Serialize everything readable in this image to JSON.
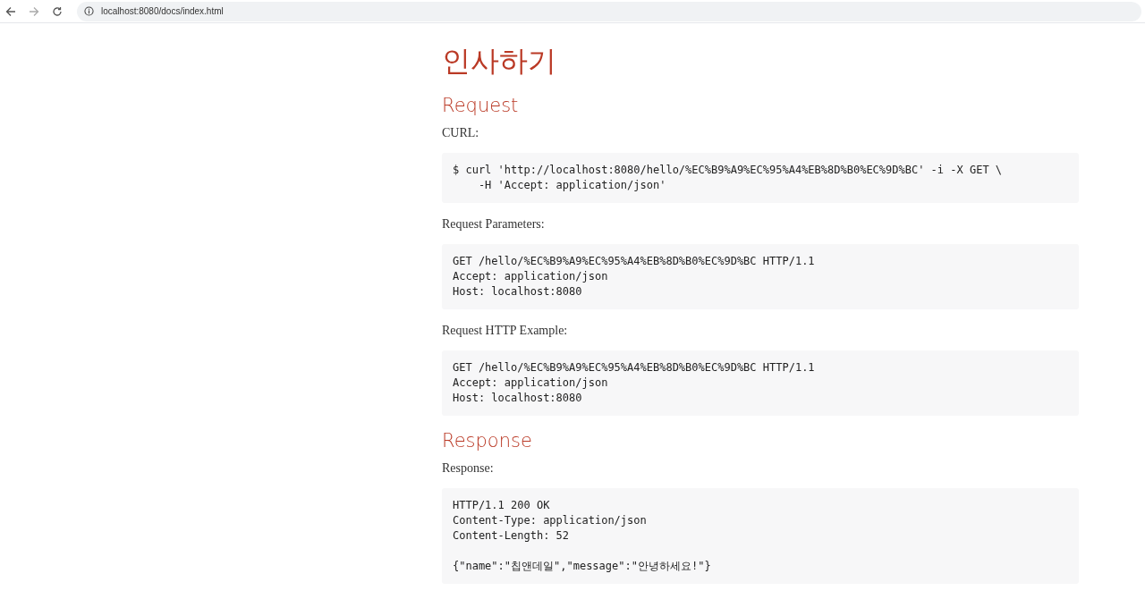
{
  "browser": {
    "address": "localhost:8080/docs/index.html"
  },
  "title": "인사하기",
  "blocks": [
    {
      "kind": "heading",
      "text": "Request"
    },
    {
      "kind": "label",
      "text": "CURL:"
    },
    {
      "kind": "code",
      "text": "$ curl 'http://localhost:8080/hello/%EC%B9%A9%EC%95%A4%EB%8D%B0%EC%9D%BC' -i -X GET \\\n    -H 'Accept: application/json'"
    },
    {
      "kind": "label",
      "text": "Request Parameters:"
    },
    {
      "kind": "code",
      "text": "GET /hello/%EC%B9%A9%EC%95%A4%EB%8D%B0%EC%9D%BC HTTP/1.1\nAccept: application/json\nHost: localhost:8080"
    },
    {
      "kind": "label",
      "text": "Request HTTP Example:"
    },
    {
      "kind": "code",
      "text": "GET /hello/%EC%B9%A9%EC%95%A4%EB%8D%B0%EC%9D%BC HTTP/1.1\nAccept: application/json\nHost: localhost:8080"
    },
    {
      "kind": "heading",
      "text": "Response"
    },
    {
      "kind": "label",
      "text": "Response:"
    },
    {
      "kind": "code",
      "text": "HTTP/1.1 200 OK\nContent-Type: application/json\nContent-Length: 52\n\n{\"name\":\"칩앤데일\",\"message\":\"안녕하세요!\"}"
    }
  ]
}
